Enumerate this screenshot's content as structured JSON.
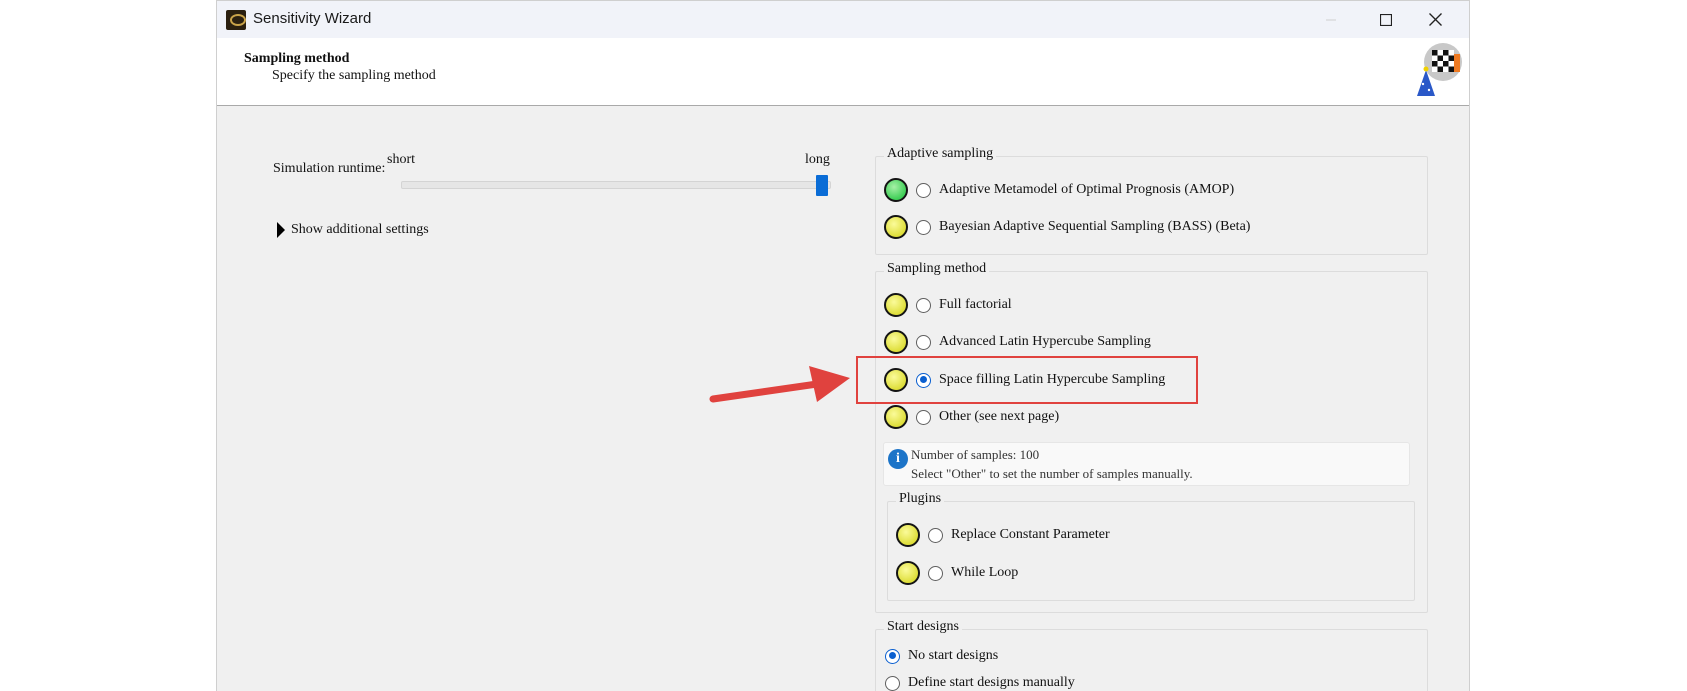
{
  "window": {
    "title": "Sensitivity Wizard"
  },
  "header": {
    "title": "Sampling method",
    "subtitle": "Specify the sampling method"
  },
  "runtime": {
    "label": "Simulation runtime:",
    "min_label": "short",
    "max_label": "long",
    "value": 1.0
  },
  "show_additional": {
    "label": "Show additional settings"
  },
  "adaptive_sampling": {
    "title": "Adaptive sampling",
    "options": [
      {
        "label": "Adaptive Metamodel of Optimal Prognosis (AMOP)",
        "indicator": "green",
        "selected": false
      },
      {
        "label": "Bayesian Adaptive Sequential Sampling (BASS) (Beta)",
        "indicator": "yellow",
        "selected": false
      }
    ]
  },
  "sampling_method": {
    "title": "Sampling method",
    "options": [
      {
        "label": "Full factorial",
        "indicator": "yellow",
        "selected": false
      },
      {
        "label": "Advanced Latin Hypercube Sampling",
        "indicator": "yellow",
        "selected": false
      },
      {
        "label": "Space filling Latin Hypercube Sampling",
        "indicator": "yellow",
        "selected": true
      },
      {
        "label": "Other (see next page)",
        "indicator": "yellow",
        "selected": false
      }
    ],
    "info": {
      "line1": "Number of samples: 100",
      "line2": "Select \"Other\" to set the number of samples manually."
    },
    "plugins": {
      "title": "Plugins",
      "options": [
        {
          "label": "Replace Constant Parameter",
          "indicator": "yellow",
          "selected": false
        },
        {
          "label": "While Loop",
          "indicator": "yellow",
          "selected": false
        }
      ]
    }
  },
  "start_designs": {
    "title": "Start designs",
    "options": [
      {
        "label": "No start designs",
        "selected": true
      },
      {
        "label": "Define start designs manually",
        "selected": false
      }
    ]
  },
  "colors": {
    "accent": "#0a6cd6",
    "highlight": "#e0423e",
    "indicator_green": "#3fcf57",
    "indicator_yellow": "#dede3a"
  }
}
